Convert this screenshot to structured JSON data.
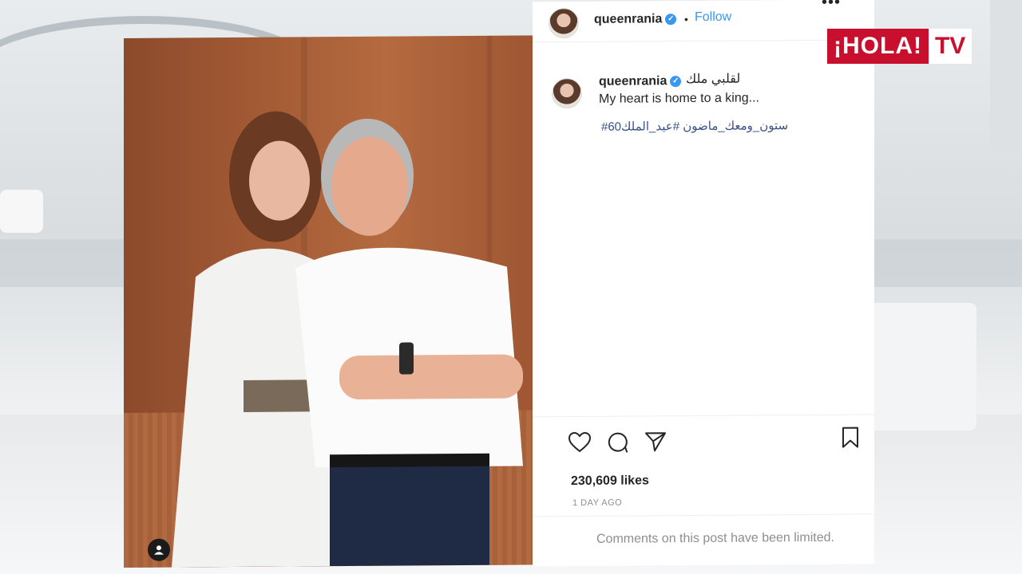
{
  "brand": {
    "hola": "¡HOLA!",
    "tv": "TV"
  },
  "post": {
    "username": "queenrania",
    "follow_label": "Follow",
    "separator": "•",
    "more_label": "•••",
    "caption_arabic": "لقلبي ملك",
    "caption_english": "My heart is home to a king...",
    "hashtags": "#ستون_ومعك_ماضون #عيد_الملك60",
    "likes": "230,609 likes",
    "date": "1 DAY AGO",
    "comments_notice": "Comments on this post have been limited."
  },
  "icons": {
    "like": "heart-icon",
    "comment": "comment-icon",
    "share": "send-icon",
    "save": "bookmark-icon",
    "profile": "user-icon",
    "verified": "verified-badge-icon"
  },
  "colors": {
    "link": "#3897f0",
    "hashtag": "#385185",
    "hola_red": "#c8102e"
  }
}
